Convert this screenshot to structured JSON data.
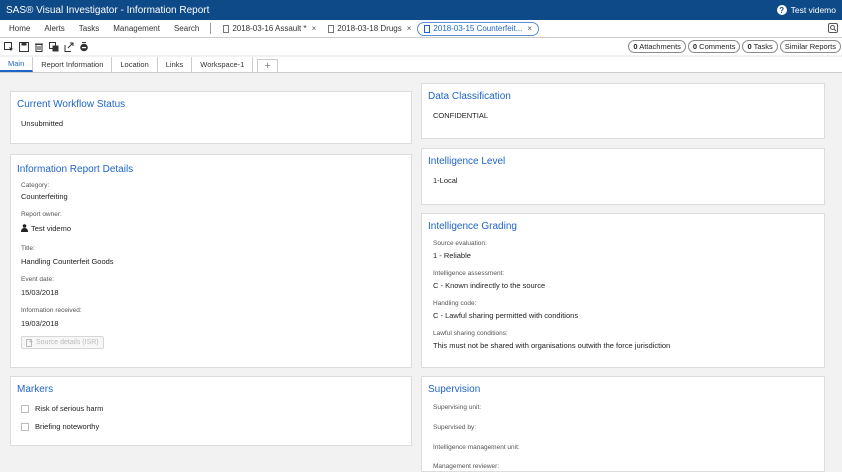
{
  "app": {
    "title": "SAS® Visual Investigator - Information Report",
    "user": "Test videmo",
    "help_icon": "help-icon"
  },
  "menu": {
    "items": [
      "Home",
      "Alerts",
      "Tasks",
      "Management",
      "Search"
    ],
    "doc_tabs": [
      {
        "label": "2018-03-16 Assault *"
      },
      {
        "label": "2018-03-18 Drugs"
      },
      {
        "label": "2018-03-15 Counterfeit..."
      }
    ],
    "active_doc_index": 2
  },
  "toolbar": {
    "icons": [
      "select-icon",
      "save-icon",
      "delete-icon",
      "copy-icon",
      "share-icon",
      "remove-icon"
    ],
    "pills": [
      {
        "count": "0",
        "label": "Attachments"
      },
      {
        "count": "0",
        "label": "Comments"
      },
      {
        "count": "0",
        "label": "Tasks"
      },
      {
        "count": "",
        "label": "Similar Reports"
      }
    ]
  },
  "tabs": [
    "Main",
    "Report Information",
    "Location",
    "Links",
    "Workspace-1"
  ],
  "active_tab_index": 0,
  "workflow": {
    "title": "Current Workflow Status",
    "value": "Unsubmitted"
  },
  "details": {
    "title": "Information Report Details",
    "fields": [
      {
        "label": "Category:",
        "value": "Counterfeiting"
      },
      {
        "label": "Report owner:",
        "value": "Test videmo"
      },
      {
        "label": "Title:",
        "value": "Handling Counterfeit Goods"
      },
      {
        "label": "Event date:",
        "value": "15/03/2018"
      },
      {
        "label": "Information received:",
        "value": "19/03/2018"
      }
    ],
    "button_label": "Source details (ISR)"
  },
  "markers": {
    "title": "Markers",
    "items": [
      "Risk of serious harm",
      "Briefing noteworthy"
    ]
  },
  "classification": {
    "title": "Data Classification",
    "value": "CONFIDENTIAL"
  },
  "level": {
    "title": "Intelligence Level",
    "value": "1-Local"
  },
  "grading": {
    "title": "Intelligence Grading",
    "fields": [
      {
        "label": "Source evaluation:",
        "value": "1 - Reliable"
      },
      {
        "label": "Intelligence assessment:",
        "value": "C - Known indirectly to the source"
      },
      {
        "label": "Handling code:",
        "value": "C - Lawful sharing permitted with conditions"
      },
      {
        "label": "Lawful sharing conditions:",
        "value": "This must not be shared with organisations outwith the force jurisdiction"
      }
    ]
  },
  "supervision": {
    "title": "Supervision",
    "fields": [
      "Supervising unit:",
      "Supervised by:",
      "Intelligence management unit:",
      "Management reviewer:"
    ]
  }
}
